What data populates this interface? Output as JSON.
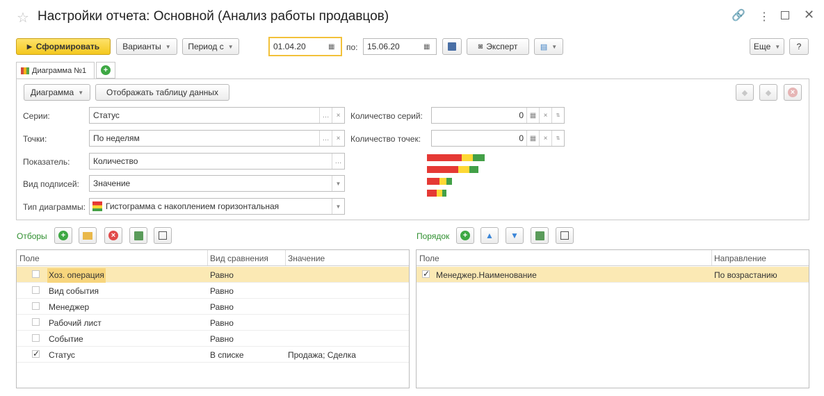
{
  "window": {
    "title": "Настройки отчета: Основной (Анализ работы продавцов)",
    "star_icon": "star-icon",
    "controls": [
      "link-icon",
      "more-icon",
      "maximize-icon",
      "close-icon"
    ]
  },
  "toolbar": {
    "generate_label": "Сформировать",
    "variants_label": "Варианты",
    "period_label": "Период с",
    "date_from": "01.04.20",
    "to_label": "по:",
    "date_to": "15.06.20",
    "expert_label": "Эксперт",
    "more_label": "Еще",
    "help_label": "?"
  },
  "tabs": {
    "active_label": "Диаграмма №1"
  },
  "diagram": {
    "diagram_menu_label": "Диаграмма",
    "show_table_label": "Отображать таблицу данных",
    "series_label": "Серии:",
    "series_value": "Статус",
    "points_label": "Точки:",
    "points_value": "По неделям",
    "indicator_label": "Показатель:",
    "indicator_value": "Количество",
    "labels_kind_label": "Вид подписей:",
    "labels_kind_value": "Значение",
    "chart_type_label": "Тип диаграммы:",
    "chart_type_value": "Гистограмма с накоплением горизонтальная",
    "series_count_label": "Количество серий:",
    "series_count_value": "0",
    "points_count_label": "Количество точек:",
    "points_count_value": "0",
    "preview_colors": [
      "#e53935",
      "#fdd835",
      "#43a047"
    ]
  },
  "filters": {
    "title": "Отборы",
    "columns": [
      "Поле",
      "Вид сравнения",
      "Значение"
    ],
    "rows": [
      {
        "field": "Хоз. операция",
        "comparison": "Равно",
        "value": "",
        "checked": false,
        "selected": true
      },
      {
        "field": "Вид события",
        "comparison": "Равно",
        "value": "",
        "checked": false,
        "selected": false
      },
      {
        "field": "Менеджер",
        "comparison": "Равно",
        "value": "",
        "checked": false,
        "selected": false
      },
      {
        "field": "Рабочий лист",
        "comparison": "Равно",
        "value": "",
        "checked": false,
        "selected": false
      },
      {
        "field": "Событие",
        "comparison": "Равно",
        "value": "",
        "checked": false,
        "selected": false
      },
      {
        "field": "Статус",
        "comparison": "В списке",
        "value": "Продажа; Сделка",
        "checked": true,
        "selected": false
      }
    ]
  },
  "order": {
    "title": "Порядок",
    "columns": [
      "Поле",
      "Направление"
    ],
    "rows": [
      {
        "field": "Менеджер.Наименование",
        "direction": "По возрастанию",
        "checked": true,
        "selected": true
      }
    ]
  }
}
